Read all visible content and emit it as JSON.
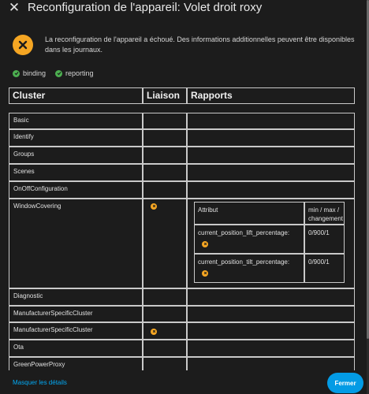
{
  "dialog": {
    "title": "Reconfiguration de l'appareil: Volet droit roxy",
    "close_icon": "close-icon"
  },
  "alert": {
    "icon": "error-x-icon",
    "color": "#f5a623",
    "message": "La reconfiguration de l'appareil a échoué. Des informations additionnelles peuvent être disponibles dans les journaux."
  },
  "status_chips": [
    {
      "label": "binding",
      "icon": "check-circle-icon",
      "color": "#4caf50"
    },
    {
      "label": "reporting",
      "icon": "check-circle-icon",
      "color": "#4caf50"
    }
  ],
  "table": {
    "headers": {
      "cluster": "Cluster",
      "liaison": "Liaison",
      "rapports": "Rapports"
    },
    "rows": [
      {
        "cluster": "Basic"
      },
      {
        "cluster": "Identify"
      },
      {
        "cluster": "Groups"
      },
      {
        "cluster": "Scenes"
      },
      {
        "cluster": "OnOffConfiguration"
      },
      {
        "cluster": "WindowCovering",
        "liaison_warning": true
      },
      {
        "cluster": "Diagnostic"
      },
      {
        "cluster": "ManufacturerSpecificCluster"
      },
      {
        "cluster": "ManufacturerSpecificCluster",
        "liaison_warning": true
      },
      {
        "cluster": "Ota"
      },
      {
        "cluster": "GreenPowerProxy"
      }
    ],
    "reports": {
      "headers": {
        "attribute": "Attribut",
        "interval": "min / max / changement"
      },
      "rows": [
        {
          "attribute": "current_position_lift_percentage:",
          "value": "0/900/1"
        },
        {
          "attribute": "current_position_tilt_percentage:",
          "value": "0/900/1"
        }
      ]
    }
  },
  "footer": {
    "details_link": "Masquer les détails",
    "close_button": "Fermer"
  },
  "colors": {
    "background": "#1c1c1c",
    "accent": "#039be5",
    "warning": "#f5a623",
    "success": "#4caf50"
  }
}
